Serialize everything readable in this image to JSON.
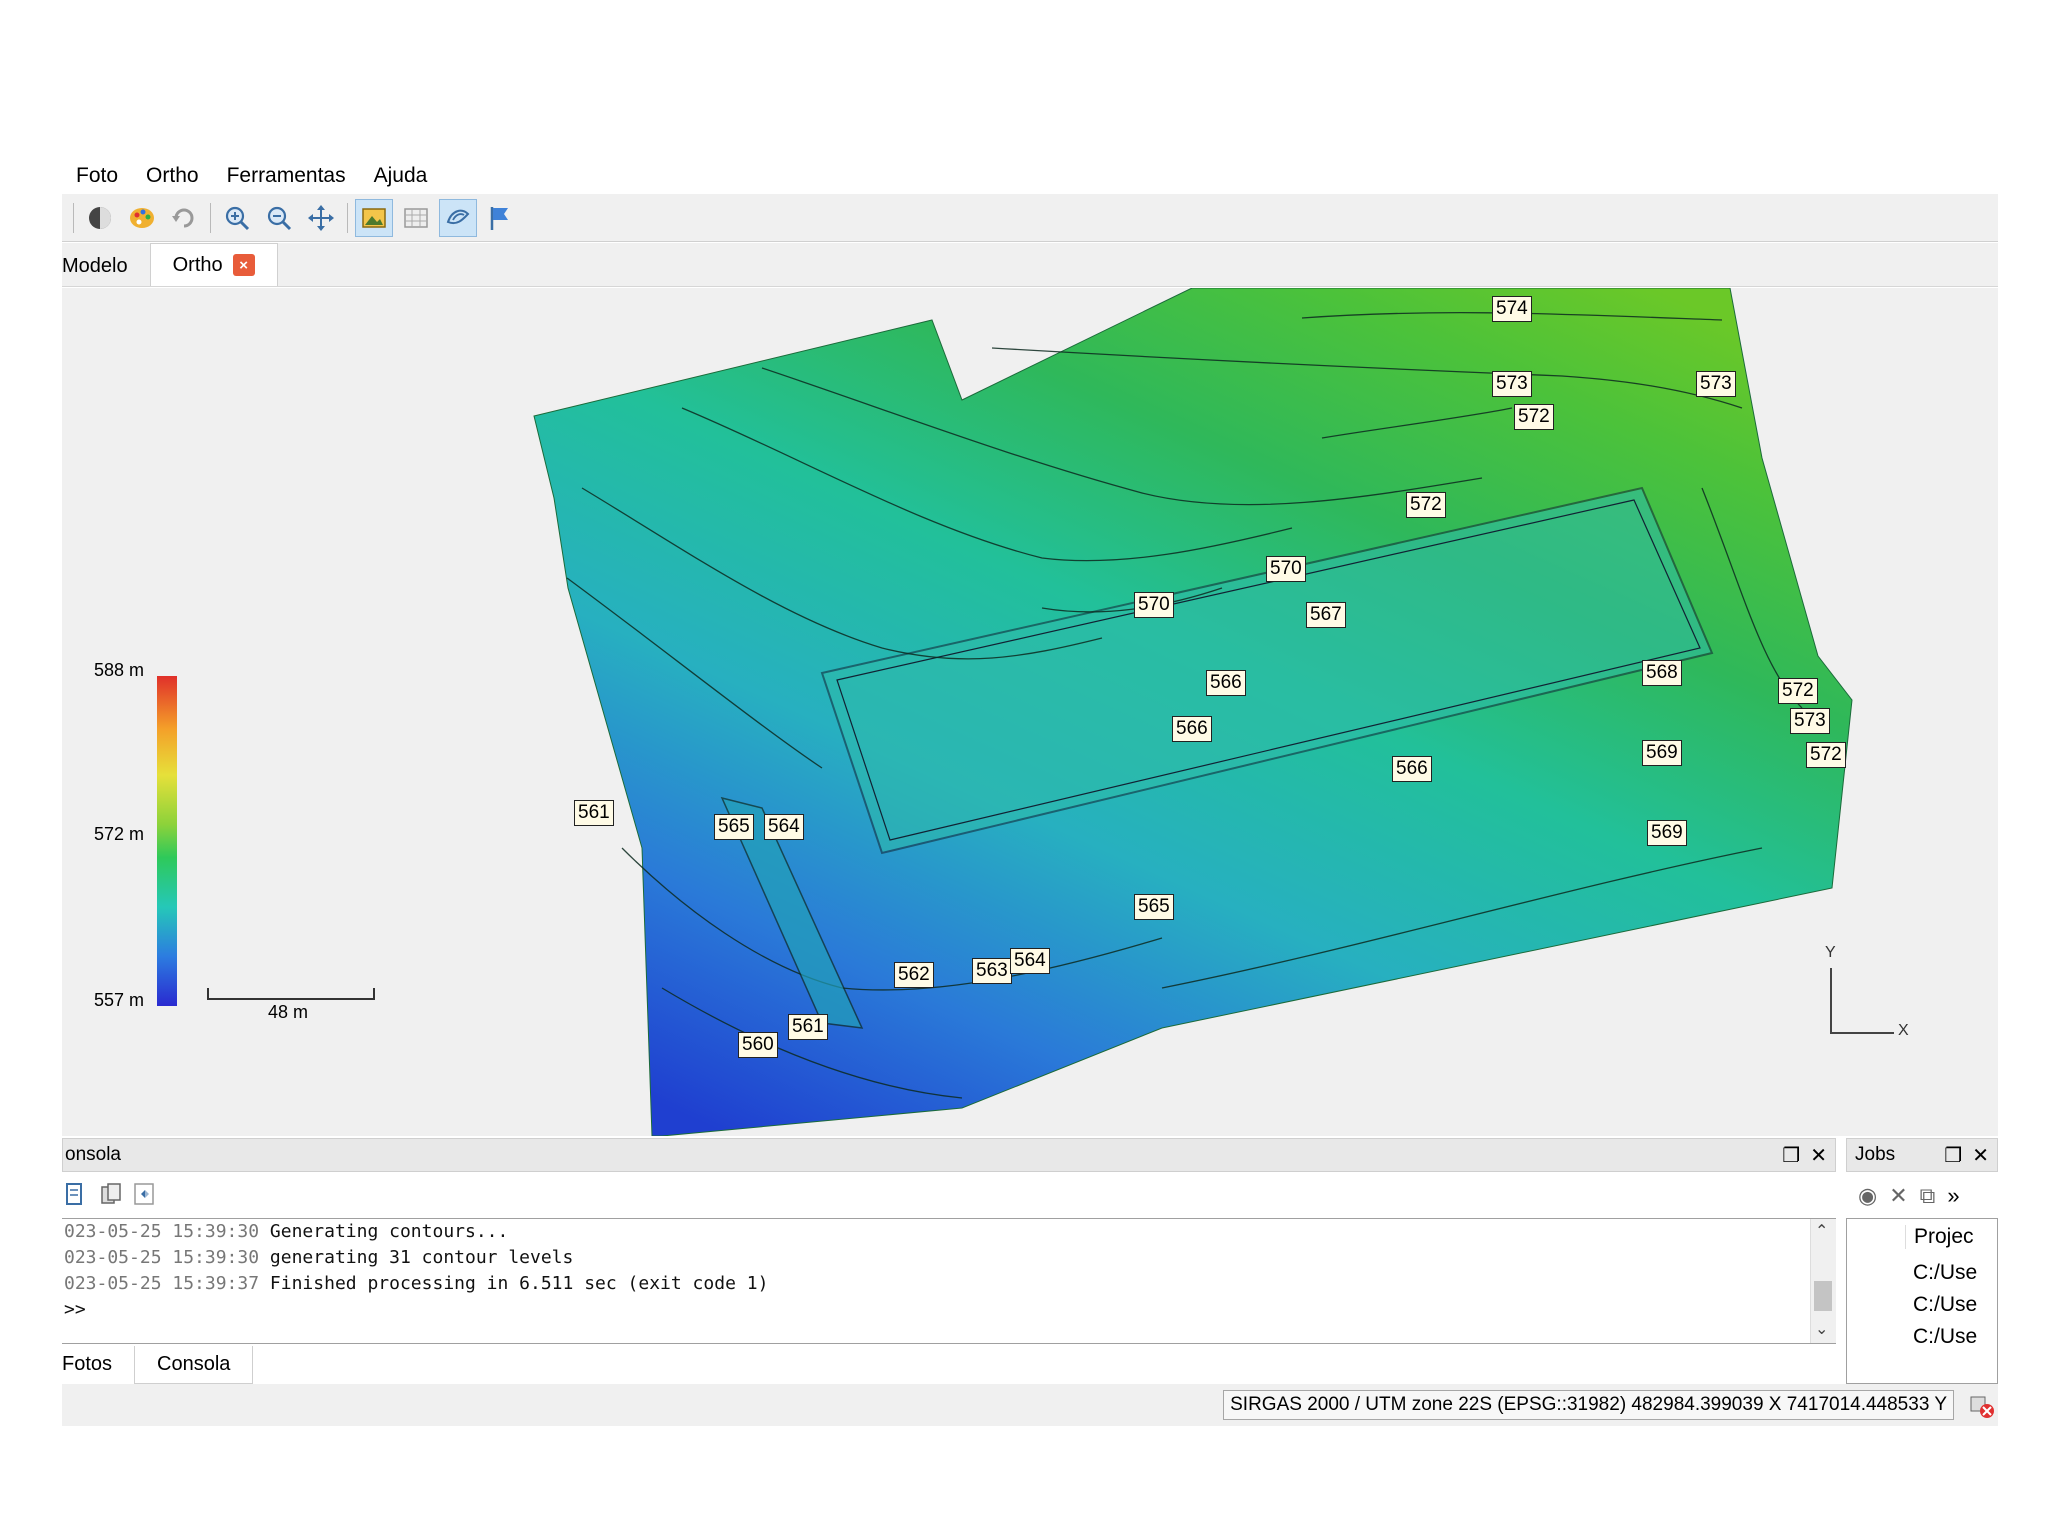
{
  "window": {
    "controls": {
      "minimize": "–",
      "restore": "❐",
      "close": "✕"
    }
  },
  "menu": [
    "Foto",
    "Ortho",
    "Ferramentas",
    "Ajuda"
  ],
  "toolbar": {
    "icons": [
      "measure-icon",
      "palette-icon",
      "rotate-icon",
      "zoom-in-icon",
      "zoom-out-icon",
      "pan-icon",
      "image-icon",
      "grid-icon",
      "contour-icon",
      "flag-icon"
    ]
  },
  "tabs": {
    "modelo": "Modelo",
    "ortho": "Ortho",
    "close": "×"
  },
  "map": {
    "legend": {
      "top": "588 m",
      "mid": "572 m",
      "bottom": "557 m"
    },
    "scale": "48 m",
    "axis": {
      "y": "Y",
      "x": "X"
    },
    "contour_labels": [
      "574",
      "573",
      "573",
      "572",
      "572",
      "570",
      "570",
      "567",
      "566",
      "566",
      "566",
      "568",
      "569",
      "569",
      "572",
      "573",
      "572",
      "561",
      "565",
      "564",
      "565",
      "562",
      "563",
      "564",
      "561",
      "560"
    ]
  },
  "console": {
    "title": "onsola",
    "lines": [
      {
        "ts": "023-05-25 15:39:30",
        "msg": "Generating contours..."
      },
      {
        "ts": "023-05-25 15:39:30",
        "msg": "generating 31 contour levels"
      },
      {
        "ts": "023-05-25 15:39:37",
        "msg": "Finished processing in 6.511 sec (exit code 1)"
      }
    ],
    "prompt": ">>"
  },
  "bottom_tabs": {
    "fotos": "Fotos",
    "consola": "Consola"
  },
  "jobs": {
    "title": "Jobs",
    "column": "Projec",
    "rows": [
      "C:/Use",
      "C:/Use",
      "C:/Use"
    ],
    "overflow": "»"
  },
  "status": {
    "coords": "SIRGAS 2000 / UTM zone 22S (EPSG::31982)  482984.399039 X  7417014.448533 Y"
  }
}
